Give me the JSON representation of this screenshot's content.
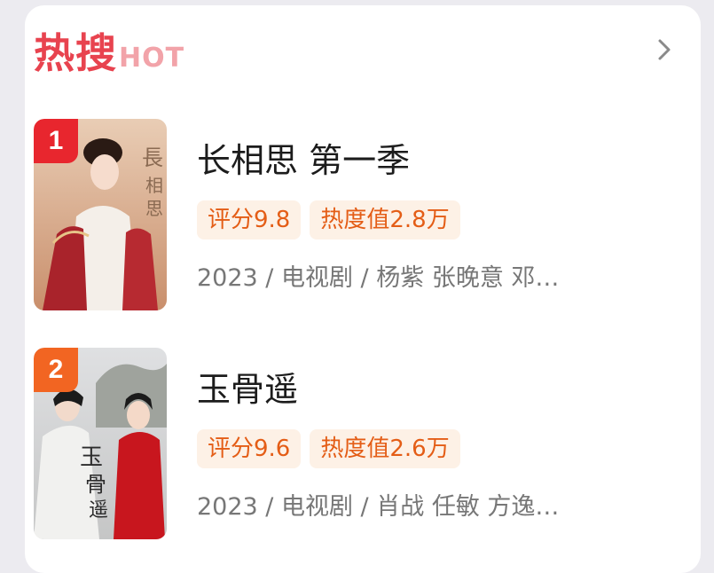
{
  "header": {
    "title": "热搜",
    "badge": "HOT",
    "more_icon": "chevron-right-icon"
  },
  "items": [
    {
      "rank": "1",
      "title": "长相思 第一季",
      "score": "评分9.8",
      "heat": "热度值2.8万",
      "meta": "2023 / 电视剧 / 杨紫 张晚意 邓…",
      "rank_color": "#e8262e"
    },
    {
      "rank": "2",
      "title": "玉骨遥",
      "score": "评分9.6",
      "heat": "热度值2.6万",
      "meta": "2023 / 电视剧 / 肖战 任敏 方逸…",
      "rank_color": "#f26522"
    }
  ],
  "colors": {
    "accent": "#e8434f",
    "tag_text": "#e45d16",
    "tag_bg": "#fdf1e6"
  }
}
